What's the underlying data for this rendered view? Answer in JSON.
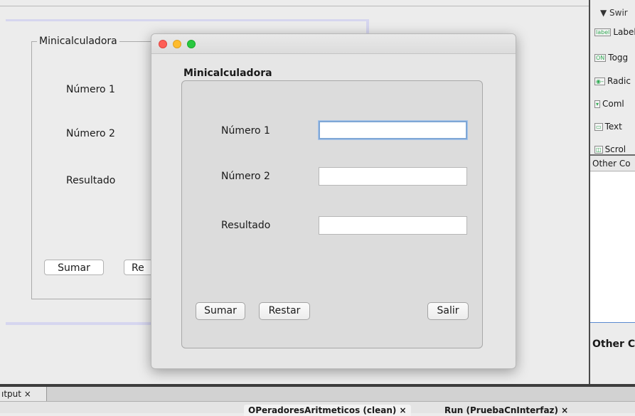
{
  "design_form": {
    "group_title": "Minicalculadora",
    "label_num1": "Número 1",
    "label_num2": "Número 2",
    "label_result": "Resultado",
    "btn_sumar": "Sumar",
    "btn_restar_partial": "Re"
  },
  "palette": {
    "header": "▼ Swir",
    "items": [
      {
        "icon": "label",
        "label": "Label"
      },
      {
        "icon": "ON",
        "label": "Togg"
      },
      {
        "icon": "◉–",
        "label": "Radic"
      },
      {
        "icon": "▾",
        "label": "Coml"
      },
      {
        "icon": "▭",
        "label": "Text"
      },
      {
        "icon": "◫",
        "label": "Scrol"
      }
    ],
    "sub_header": "Other Co",
    "bottom_title": "Other C"
  },
  "bottom": {
    "output_tab": "ıtput ×",
    "run_tab_1": "OPeradoresAritmeticos (clean)  ×",
    "run_tab_2": "Run (PruebaCnInterfaz)  ×"
  },
  "window": {
    "heading": "Minicalculadora",
    "label_num1": "Número 1",
    "label_num2": "Número 2",
    "label_result": "Resultado",
    "field_num1": "",
    "field_num2": "",
    "field_result": "",
    "btn_sumar": "Sumar",
    "btn_restar": "Restar",
    "btn_salir": "Salir"
  },
  "colors": {
    "close": "#fe5f57",
    "minimize": "#febc2e",
    "zoom": "#28c840",
    "focus_ring": "#7fa7d6"
  }
}
